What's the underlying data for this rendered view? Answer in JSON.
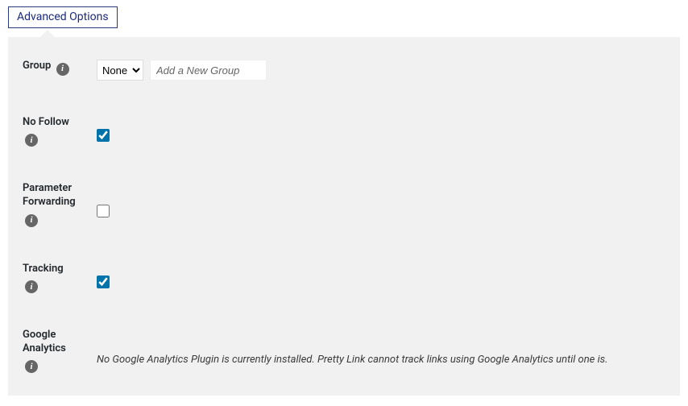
{
  "tab": {
    "label": "Advanced Options"
  },
  "rows": {
    "group": {
      "label": "Group",
      "selected": "None",
      "options": [
        "None"
      ],
      "newGroupPlaceholder": "Add a New Group"
    },
    "noFollow": {
      "label": "No Follow",
      "checked": true
    },
    "paramFwd": {
      "label": "Parameter Forwarding",
      "checked": false
    },
    "tracking": {
      "label": "Tracking",
      "checked": true
    },
    "ga": {
      "label": "Google Analytics",
      "note": "No Google Analytics Plugin is currently installed. Pretty Link cannot track links using Google Analytics until one is."
    }
  },
  "infoGlyph": "i"
}
